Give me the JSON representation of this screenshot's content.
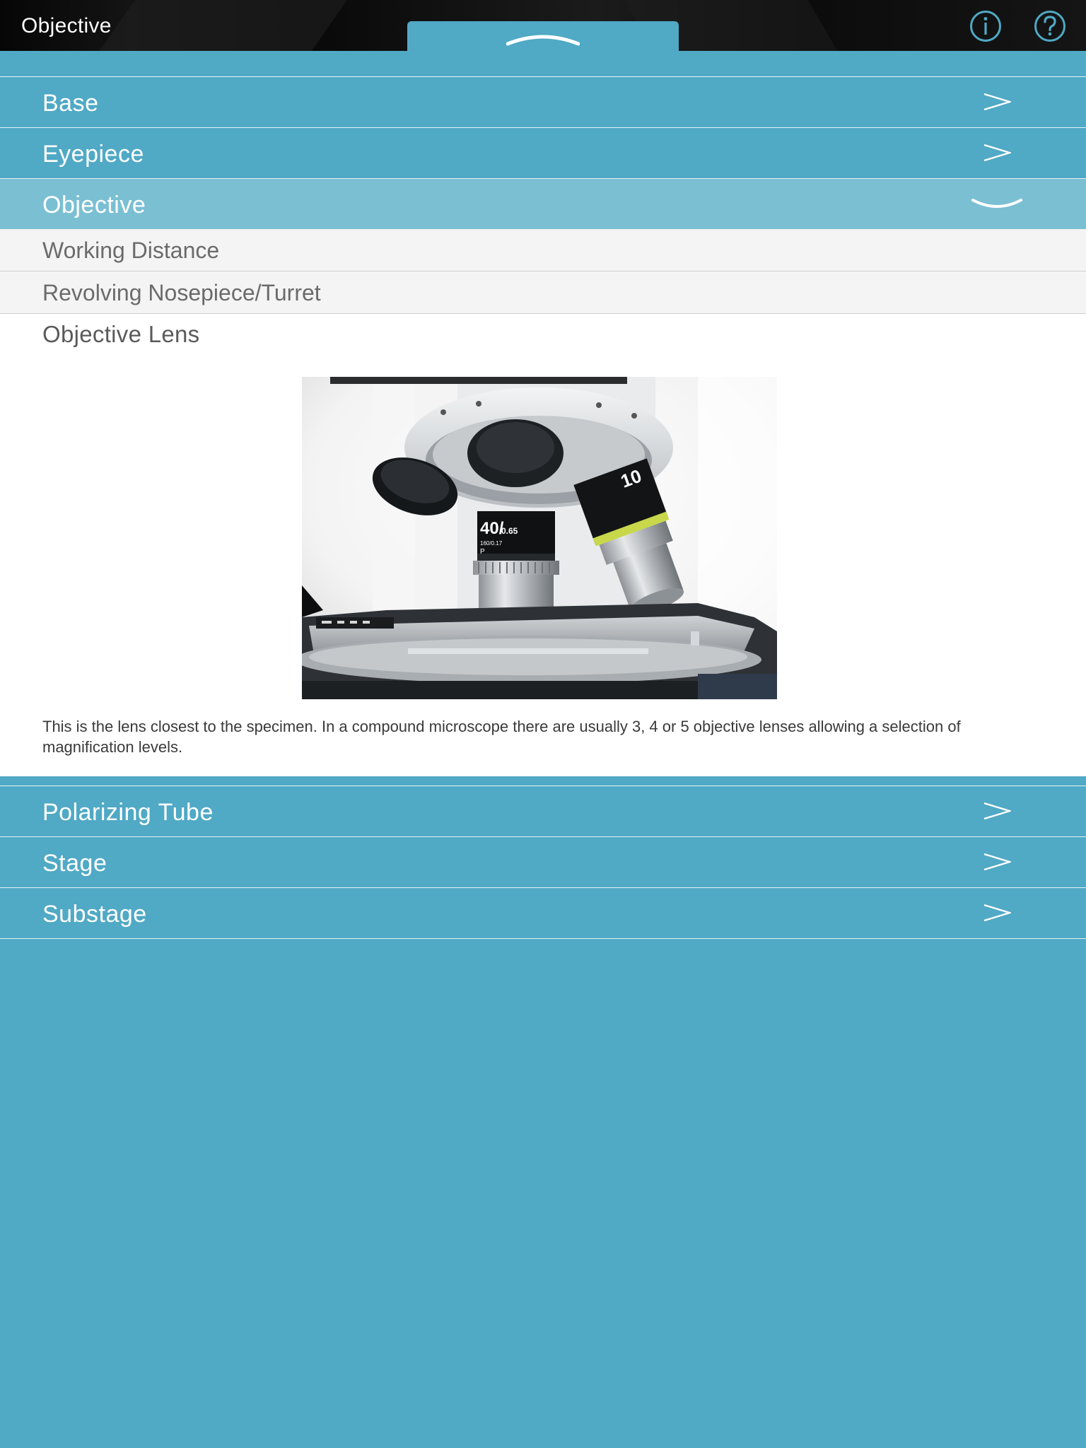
{
  "header": {
    "title": "Objective"
  },
  "accordion": {
    "top_items": [
      "Base",
      "Eyepiece"
    ],
    "active_item": "Objective",
    "sub_items": [
      "Working Distance",
      "Revolving Nosepiece/Turret"
    ],
    "detail": {
      "title": "Objective Lens",
      "description": "This is the lens closest to the specimen. In a compound microscope there are usually 3, 4 or 5 objective lenses allowing a selection of magnification levels.",
      "lens_marking_main": "40/",
      "lens_marking_na": "0.65",
      "lens_marking_sub": "160/0.17",
      "lens_marking_p": "P",
      "lens_marking_side": "10"
    },
    "bottom_items": [
      "Polarizing Tube",
      "Stage",
      "Substage"
    ]
  },
  "colors": {
    "accent": "#50a9c5",
    "active_row": "#7bbfd3",
    "sub_item_bg": "#f4f4f4",
    "topbar": "#0a0a0a"
  },
  "icons": [
    "chevron-up-icon",
    "info-icon",
    "help-icon",
    "chevron-right-icon",
    "chevron-down-icon"
  ]
}
